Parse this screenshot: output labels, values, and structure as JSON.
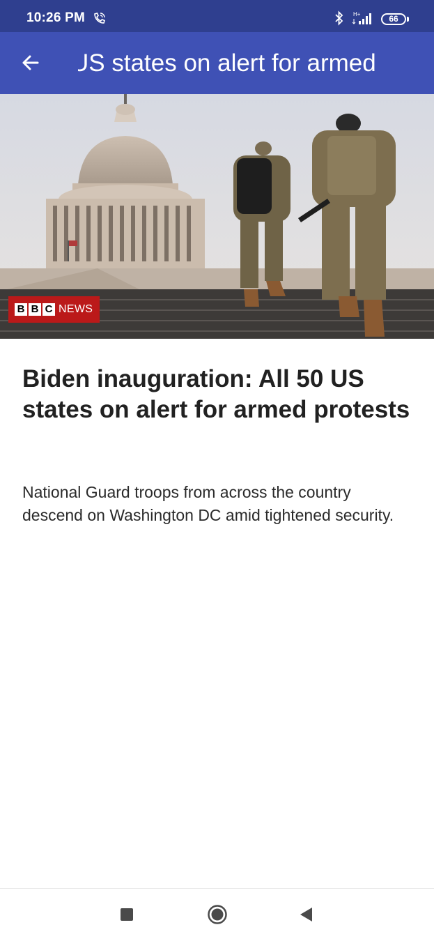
{
  "status_bar": {
    "time": "10:26 PM",
    "battery": "66",
    "icons": [
      "wifi-calling-icon",
      "bluetooth-icon",
      "signal-icon",
      "battery-icon"
    ]
  },
  "app_bar": {
    "title": "US states on alert for armed",
    "back_icon": "arrow-left-icon"
  },
  "hero_image": {
    "logo_boxes": [
      "B",
      "B",
      "C"
    ],
    "logo_news": "NEWS"
  },
  "article": {
    "headline": "Biden inauguration: All 50 US states on alert for armed protests",
    "summary": "National Guard troops from across the country descend on Washington DC amid tightened security."
  },
  "nav_bar": {
    "icons": [
      "recent-apps-icon",
      "home-icon",
      "back-icon"
    ]
  },
  "colors": {
    "status_bar": "#2f3f8f",
    "app_bar": "#3f51b5",
    "bbc_red": "#bb1919"
  }
}
